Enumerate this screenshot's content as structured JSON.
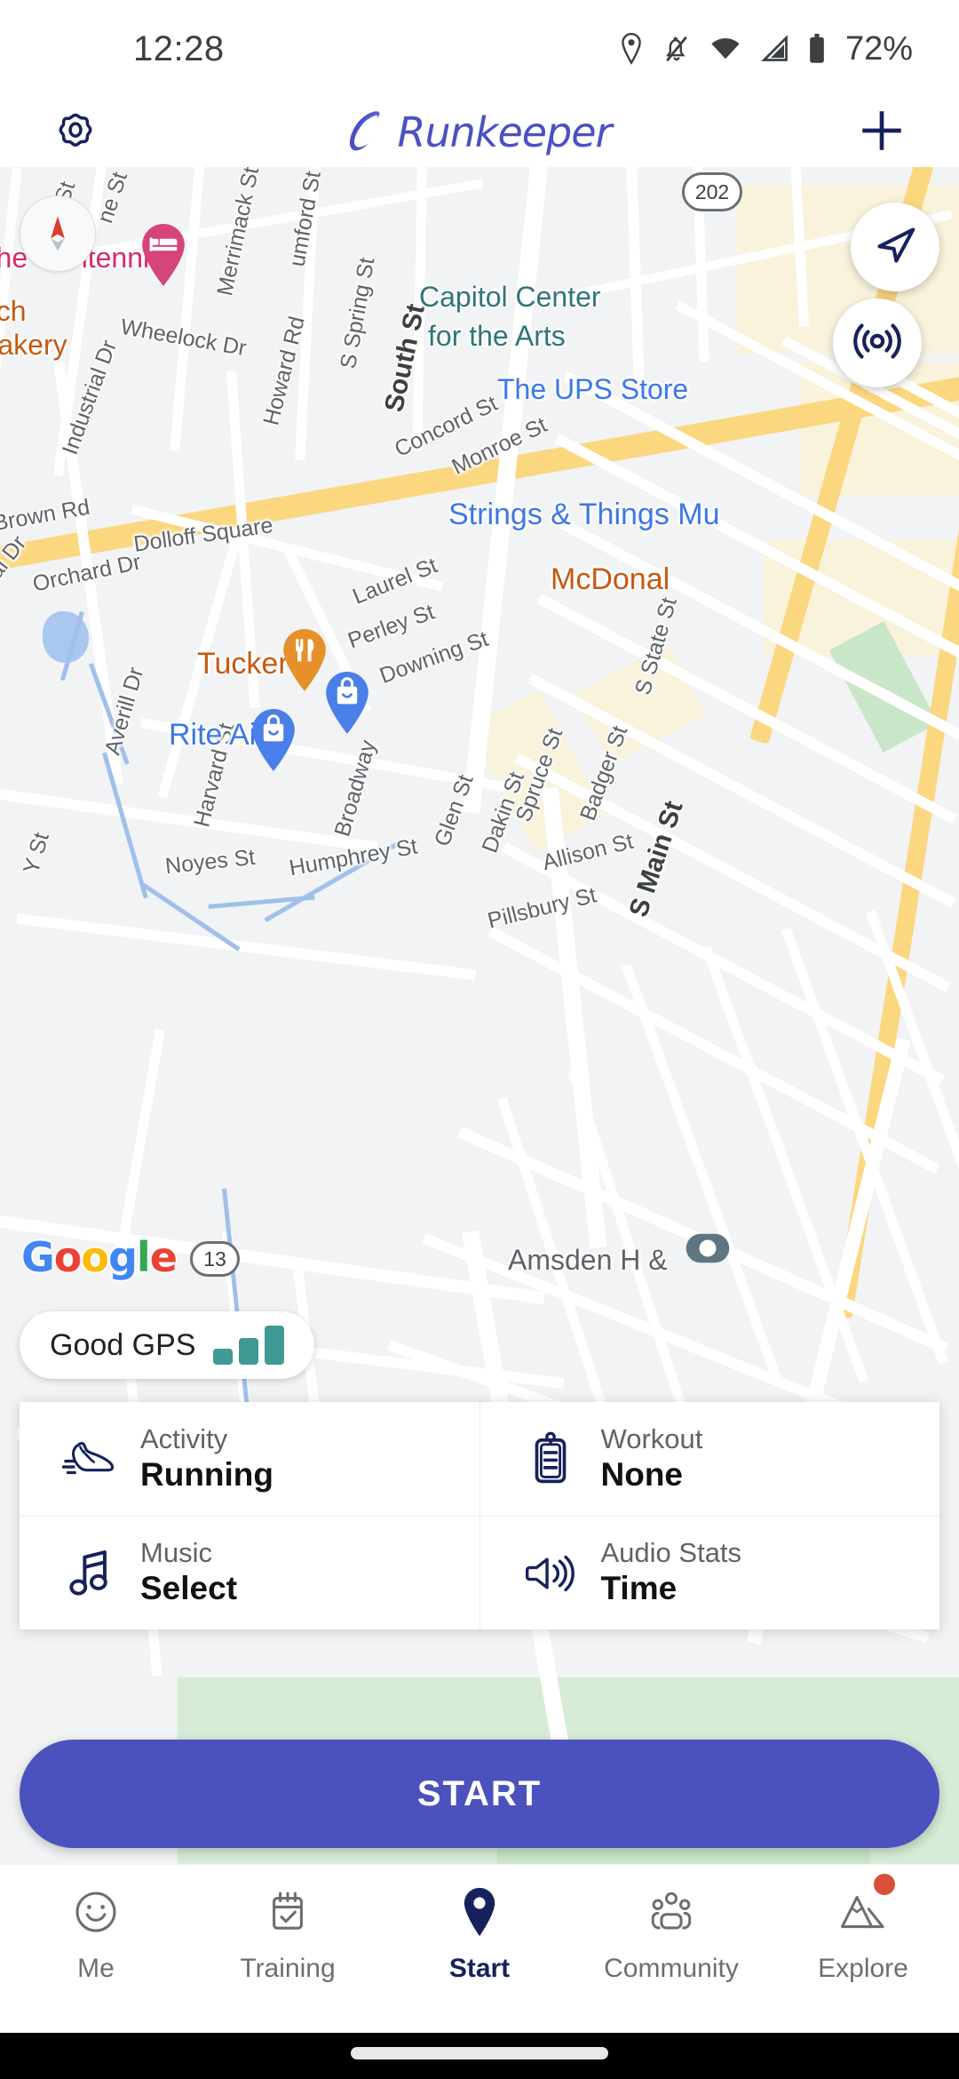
{
  "status_bar": {
    "time": "12:28",
    "battery_text": "72%",
    "icons": [
      "location-pin-icon",
      "notifications-off-icon",
      "wifi-icon",
      "cell-signal-icon",
      "battery-icon"
    ]
  },
  "header": {
    "settings_icon": "gear-icon",
    "brand": "Runkeeper",
    "add_icon": "plus-icon"
  },
  "map": {
    "provider": "Google",
    "provider_letters": [
      "G",
      "o",
      "o",
      "g",
      "l",
      "e"
    ],
    "compass_icon": "compass-icon",
    "locate_button_icon": "navigation-arrow-icon",
    "live_button_icon": "broadcast-icon",
    "gps_status": {
      "label": "Good GPS",
      "bars": 3,
      "bar_color": "#3f9a95"
    },
    "street_labels": [
      "St",
      "ne St",
      "Merrimack St",
      "umford St",
      "S Spring St",
      "South St",
      "Wheelock Dr",
      "Howard Rd",
      "Industrial Dr",
      "Brown Rd",
      "Dolloff Square",
      "al Dr",
      "Orchard Dr",
      "Averill Dr",
      "Harvard St",
      "Noyes St",
      "Y St",
      "Concord St",
      "Monroe St",
      "Laurel St",
      "Perley St",
      "Downing St",
      "Broadway",
      "Humphrey St",
      "Glen St",
      "Dakin St",
      "Spruce St",
      "Badger St",
      "Allison St",
      "S State St",
      "Pillsbury St",
      "S Main St"
    ],
    "route_shields": [
      "202",
      "13"
    ],
    "pois": [
      {
        "name": "The Centennial",
        "color": "#d62b6e",
        "marker": "hotel-pin",
        "marker_icon": "bed-icon"
      },
      {
        "name": "ach",
        "color": "#c55a11",
        "marker": "none"
      },
      {
        "name": "Bakery",
        "color": "#c55a11",
        "marker": "none"
      },
      {
        "name": "Capitol Center",
        "color": "#30757a",
        "marker": "none"
      },
      {
        "name": "for the Arts",
        "color": "#30757a",
        "marker": "none"
      },
      {
        "name": "The UPS Store",
        "color": "#3b78e7",
        "marker": "none"
      },
      {
        "name": "Strings & Things Mu",
        "color": "#3b78e7",
        "marker": "none"
      },
      {
        "name": "McDonal",
        "color": "#c55a11",
        "marker": "none"
      },
      {
        "name": "Tucker's",
        "color": "#c55a11",
        "marker": "restaurant-pin",
        "marker_icon": "fork-knife-icon"
      },
      {
        "name": "Rite Aid",
        "color": "#3b78e7",
        "marker": "shop-pin",
        "marker_icon": "shopping-bag-icon"
      },
      {
        "name": "Amsden H & ",
        "color": "#5f6368",
        "marker": "none"
      }
    ]
  },
  "options": [
    [
      {
        "icon": "running-shoe-icon",
        "label": "Activity",
        "value": "Running"
      },
      {
        "icon": "clipboard-icon",
        "label": "Workout",
        "value": "None"
      }
    ],
    [
      {
        "icon": "music-note-icon",
        "label": "Music",
        "value": "Select"
      },
      {
        "icon": "speaker-icon",
        "label": "Audio Stats",
        "value": "Time"
      }
    ]
  ],
  "start_button": {
    "label": "START",
    "color": "#4b51bd"
  },
  "bottom_nav": {
    "active_color": "#16225c",
    "inactive_color": "#6b6f73",
    "items": [
      {
        "icon": "smiley-face-icon",
        "label": "Me",
        "active": false,
        "badge": false
      },
      {
        "icon": "calendar-check-icon",
        "label": "Training",
        "active": false,
        "badge": false
      },
      {
        "icon": "location-pin-icon",
        "label": "Start",
        "active": true,
        "badge": false
      },
      {
        "icon": "people-group-icon",
        "label": "Community",
        "active": false,
        "badge": false
      },
      {
        "icon": "mountains-icon",
        "label": "Explore",
        "active": false,
        "badge": true
      }
    ]
  }
}
